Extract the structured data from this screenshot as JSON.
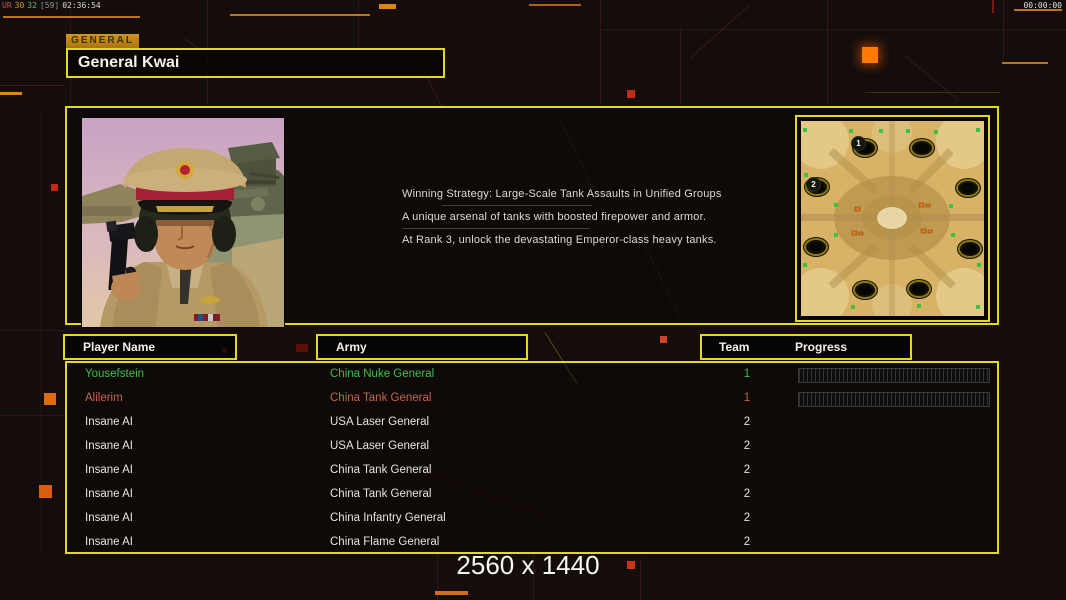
{
  "colors": {
    "accent_yellow": "#e3da1d",
    "accent_orange": "#e07818",
    "player_green": "#43bd4c",
    "player_red": "#c4664e",
    "ai_white": "#e6e4e0"
  },
  "hud": {
    "gentool": {
      "prefix": "UR",
      "value_a": "30",
      "value_b": "32",
      "value_c": "[59]",
      "clock": "02:36:54"
    },
    "match_timer": "00:00:00",
    "resolution": "2560 x 1440"
  },
  "header": {
    "tab_label": "GENERAL",
    "title": "General Kwai"
  },
  "general_info": {
    "lines": [
      "Winning Strategy: Large-Scale Tank Assaults in Unified Groups",
      "A unique arsenal of tanks with boosted firepower and armor.",
      "At Rank 3, unlock the devastating Emperor-class heavy tanks."
    ]
  },
  "map": {
    "start_markers": [
      {
        "label": "1"
      },
      {
        "label": "2"
      }
    ]
  },
  "table": {
    "headers": {
      "player": "Player Name",
      "army": "Army",
      "team": "Team",
      "progress": "Progress"
    },
    "players": [
      {
        "name": "Yousefstein",
        "army": "China Nuke General",
        "team": "1",
        "color": "#43bd4c",
        "has_progress": true
      },
      {
        "name": "Alilerim",
        "army": "China Tank General",
        "team": "1",
        "color": "#c4664e",
        "has_progress": true
      },
      {
        "name": "Insane AI",
        "army": "USA Laser General",
        "team": "2",
        "color": "#e6e4e0",
        "has_progress": false
      },
      {
        "name": "Insane AI",
        "army": "USA Laser General",
        "team": "2",
        "color": "#e6e4e0",
        "has_progress": false
      },
      {
        "name": "Insane AI",
        "army": "China Tank General",
        "team": "2",
        "color": "#e6e4e0",
        "has_progress": false
      },
      {
        "name": "Insane AI",
        "army": "China Tank General",
        "team": "2",
        "color": "#e6e4e0",
        "has_progress": false
      },
      {
        "name": "Insane AI",
        "army": "China Infantry General",
        "team": "2",
        "color": "#e6e4e0",
        "has_progress": false
      },
      {
        "name": "Insane AI",
        "army": "China Flame General",
        "team": "2",
        "color": "#e6e4e0",
        "has_progress": false
      }
    ]
  }
}
